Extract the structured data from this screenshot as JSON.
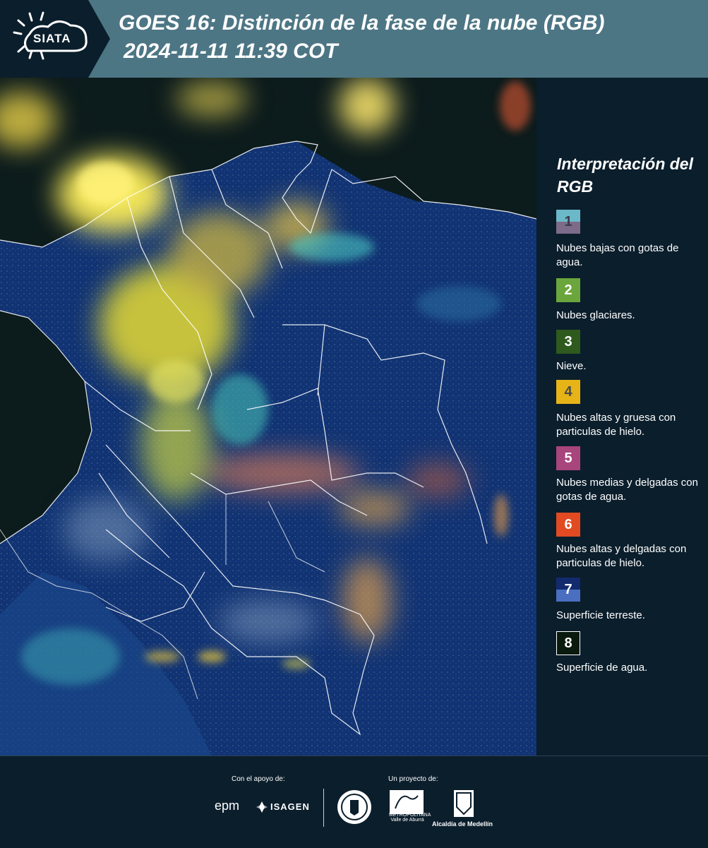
{
  "header": {
    "logo_text": "SIATA",
    "title_line1": "GOES 16: Distinción de la fase de la nube (RGB)",
    "title_line2": "2024-11-11 11:39 COT",
    "background_color": "#4d7685"
  },
  "legend": {
    "title": "Interpretación del RGB",
    "items": [
      {
        "number": "1",
        "label": "Nubes bajas con gotas de agua.",
        "color_top": "#6bb9c8",
        "color_bottom": "#7d6b8a"
      },
      {
        "number": "2",
        "label": "Nubes glaciares.",
        "color_top": "#6aa63b",
        "color_bottom": "#6aa63b"
      },
      {
        "number": "3",
        "label": "Nieve.",
        "color_top": "#2e5a1e",
        "color_bottom": "#2e5a1e"
      },
      {
        "number": "4",
        "label": "Nubes altas y gruesa con particulas de hielo.",
        "color_top": "#e6b417",
        "color_bottom": "#e6b417"
      },
      {
        "number": "5",
        "label": "Nubes medias y delgadas con gotas de agua.",
        "color_top": "#a8457c",
        "color_bottom": "#a8457c"
      },
      {
        "number": "6",
        "label": "Nubes altas y delgadas con particulas de hielo.",
        "color_top": "#e24a22",
        "color_bottom": "#e24a22"
      },
      {
        "number": "7",
        "label": "Superficie terreste.",
        "color_top": "#132a6e",
        "color_bottom": "#4a6fc0"
      },
      {
        "number": "8",
        "label": "Superficie de agua.",
        "color_top": "#0a1a0e",
        "color_bottom": "#0a1a0e"
      }
    ]
  },
  "footer": {
    "support_label": "Con el apoyo de:",
    "project_label": "Un proyecto de:",
    "epm": "epm",
    "isagen": "ISAGEN",
    "amva": "METROPOLITANA Valle de Aburrá",
    "alcaldia": "Alcaldía de Medellín"
  }
}
